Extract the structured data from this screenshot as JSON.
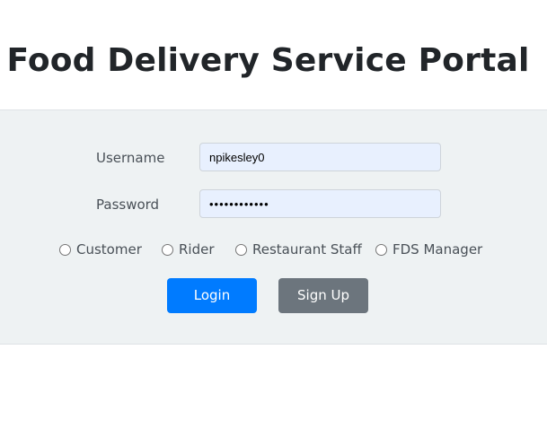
{
  "header": {
    "title": "Food Delivery Service Portal"
  },
  "form": {
    "username": {
      "label": "Username",
      "value": "npikesley0"
    },
    "password": {
      "label": "Password",
      "value": "••••••••••••"
    },
    "roles": [
      {
        "label": "Customer"
      },
      {
        "label": "Rider"
      },
      {
        "label": "Restaurant Staff"
      },
      {
        "label": "FDS Manager"
      }
    ],
    "login_label": "Login",
    "signup_label": "Sign Up"
  },
  "colors": {
    "primary": "#007bff",
    "secondary": "#6c757d",
    "panel_bg": "#eef2f3",
    "input_bg": "#e8f0fe"
  }
}
